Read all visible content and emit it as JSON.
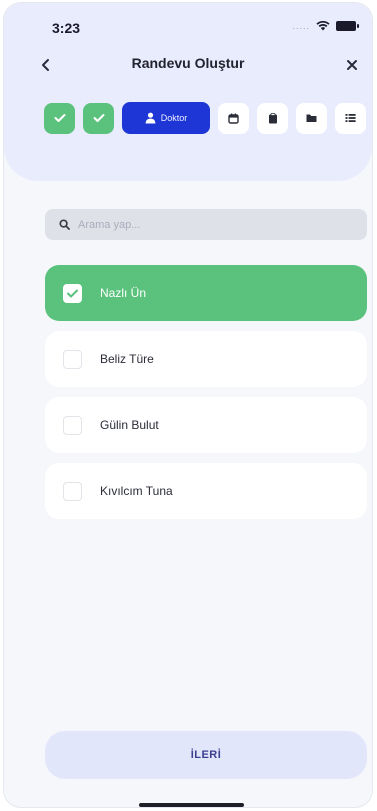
{
  "status": {
    "time": "3:23",
    "signal_dots": "....."
  },
  "nav": {
    "title": "Randevu Oluştur"
  },
  "steps": {
    "active_label": "Doktor"
  },
  "search": {
    "placeholder": "Arama yap..."
  },
  "list": {
    "items": [
      {
        "label": "Nazlı Ün",
        "selected": true
      },
      {
        "label": "Beliz Türe",
        "selected": false
      },
      {
        "label": "Gülin Bulut",
        "selected": false
      },
      {
        "label": "Kıvılcım Tuna",
        "selected": false
      }
    ]
  },
  "footer": {
    "next_label": "İLERİ"
  },
  "colors": {
    "header_bg": "#e9ecfd",
    "accent_green": "#5bc27d",
    "active_blue": "#1e36d6",
    "button_bg": "#e2e6fb"
  }
}
